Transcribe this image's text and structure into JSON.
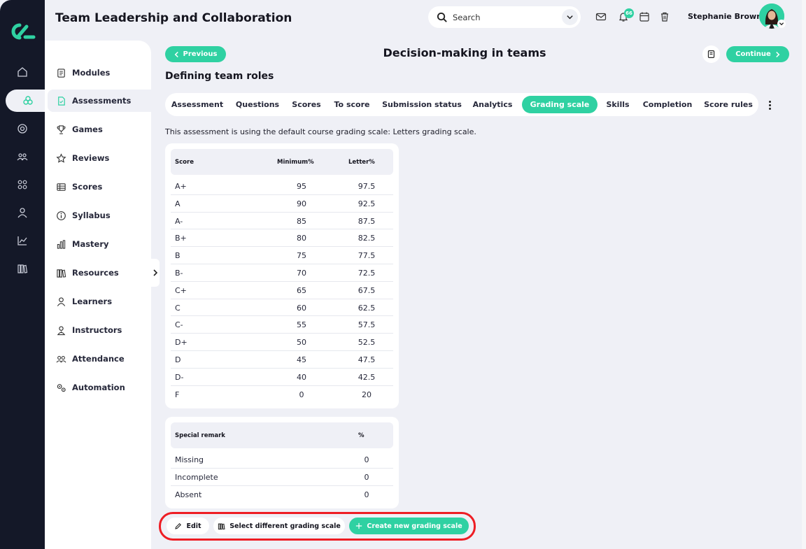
{
  "header": {
    "app_title": "Team Leadership and Collaboration",
    "search_placeholder": "Search",
    "notification_count": "66",
    "user_name": "Stephanie Brown"
  },
  "sidebar": {
    "items": [
      {
        "label": "Modules",
        "icon": "modules-icon"
      },
      {
        "label": "Assessments",
        "icon": "assessment-icon"
      },
      {
        "label": "Games",
        "icon": "trophy-icon"
      },
      {
        "label": "Reviews",
        "icon": "star-icon"
      },
      {
        "label": "Scores",
        "icon": "table-icon"
      },
      {
        "label": "Syllabus",
        "icon": "info-icon"
      },
      {
        "label": "Mastery",
        "icon": "bar-chart-icon"
      },
      {
        "label": "Resources",
        "icon": "books-icon"
      },
      {
        "label": "Learners",
        "icon": "user-icon"
      },
      {
        "label": "Instructors",
        "icon": "instructor-icon"
      },
      {
        "label": "Attendance",
        "icon": "group-icon"
      },
      {
        "label": "Automation",
        "icon": "gears-icon"
      }
    ],
    "active": "Assessments"
  },
  "page": {
    "previous_label": "Previous",
    "title": "Decision-making in teams",
    "continue_label": "Continue",
    "section_title": "Defining team roles",
    "info_text": "This assessment is using the default course grading scale: Letters grading scale."
  },
  "tabs": [
    "Assessment",
    "Questions",
    "Scores",
    "To score",
    "Submission status",
    "Analytics",
    "Grading scale",
    "Skills",
    "Completion",
    "Score rules"
  ],
  "active_tab": "Grading scale",
  "grading_table": {
    "headers": [
      "Score",
      "Minimum%",
      "Letter%"
    ],
    "rows": [
      [
        "A+",
        "95",
        "97.5"
      ],
      [
        "A",
        "90",
        "92.5"
      ],
      [
        "A-",
        "85",
        "87.5"
      ],
      [
        "B+",
        "80",
        "82.5"
      ],
      [
        "B",
        "75",
        "77.5"
      ],
      [
        "B-",
        "70",
        "72.5"
      ],
      [
        "C+",
        "65",
        "67.5"
      ],
      [
        "C",
        "60",
        "62.5"
      ],
      [
        "C-",
        "55",
        "57.5"
      ],
      [
        "D+",
        "50",
        "52.5"
      ],
      [
        "D",
        "45",
        "47.5"
      ],
      [
        "D-",
        "40",
        "42.5"
      ],
      [
        "F",
        "0",
        "20"
      ]
    ]
  },
  "remarks_table": {
    "headers": [
      "Special remark",
      "%"
    ],
    "rows": [
      [
        "Missing",
        "0"
      ],
      [
        "Incomplete",
        "0"
      ],
      [
        "Absent",
        "0"
      ]
    ]
  },
  "actions": {
    "edit_label": "Edit",
    "select_label": "Select different grading scale",
    "create_label": "Create new grading scale"
  },
  "colors": {
    "accent": "#2fd1a2",
    "rail": "#141828",
    "highlight": "#ee1d24"
  }
}
